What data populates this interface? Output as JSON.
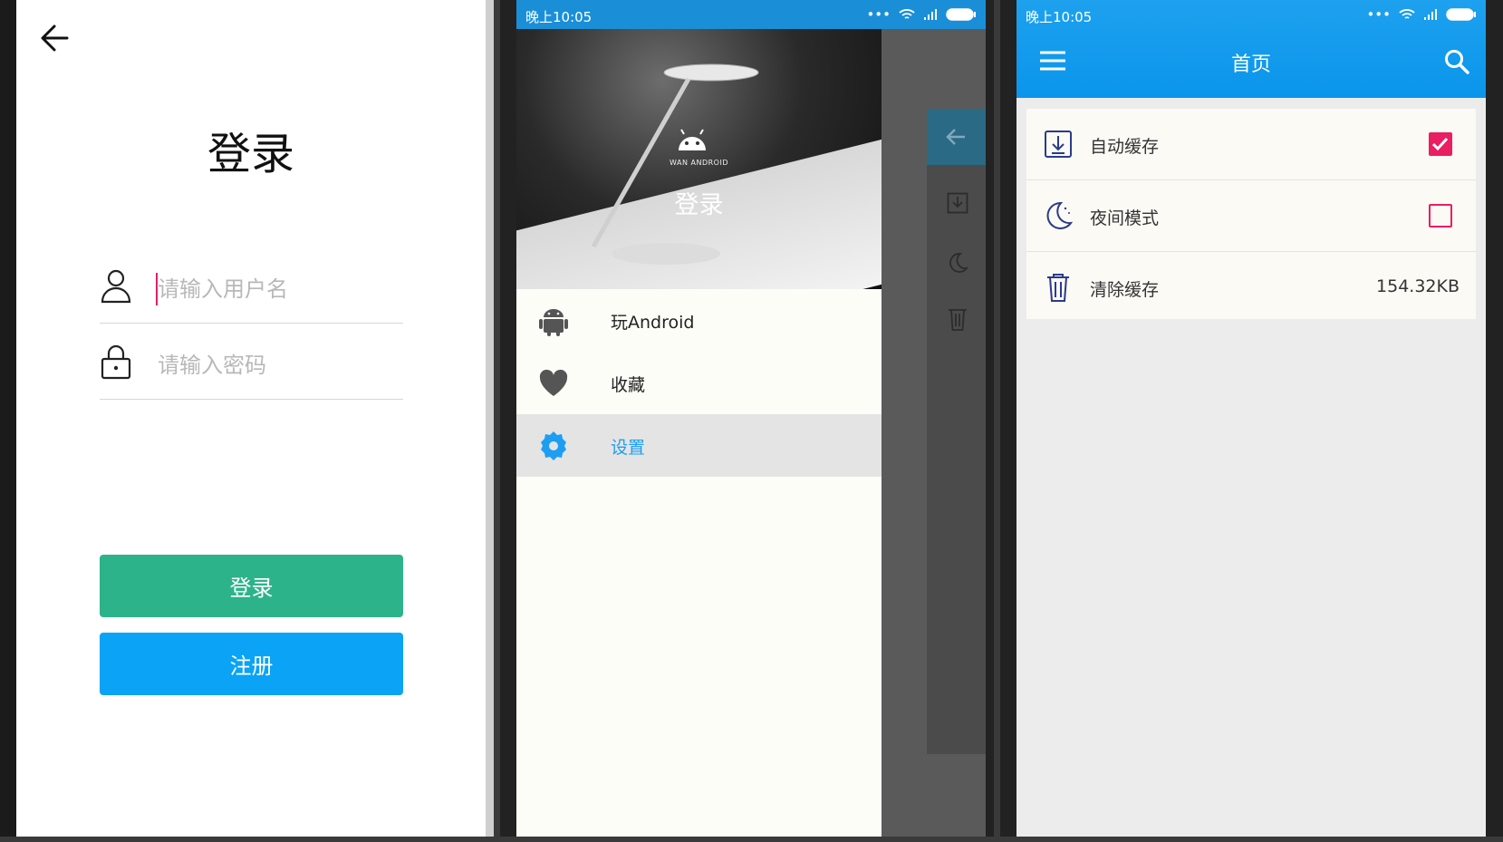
{
  "colors": {
    "accent_green": "#2db38a",
    "accent_blue": "#0aa3f5",
    "appbar_blue": "#0a95ec",
    "checkbox_pink": "#e91e63",
    "selected_menu_text": "#1e9ef2"
  },
  "login": {
    "title": "登录",
    "username_placeholder": "请输入用户名",
    "password_placeholder": "请输入密码",
    "login_button": "登录",
    "register_button": "注册"
  },
  "drawer": {
    "status_time": "晚上10:05",
    "header_brand": "WAN ANDROID",
    "header_login": "登录",
    "items": [
      {
        "label": "玩Android",
        "icon": "android-icon"
      },
      {
        "label": "收藏",
        "icon": "heart-icon"
      },
      {
        "label": "设置",
        "icon": "gear-icon",
        "selected": true
      }
    ]
  },
  "settings": {
    "status_time": "晚上10:05",
    "title": "首页",
    "rows": [
      {
        "label": "自动缓存",
        "icon": "download-icon",
        "checked": true
      },
      {
        "label": "夜间模式",
        "icon": "moon-icon",
        "checked": false
      },
      {
        "label": "清除缓存",
        "icon": "trash-icon",
        "value": "154.32KB"
      }
    ]
  }
}
